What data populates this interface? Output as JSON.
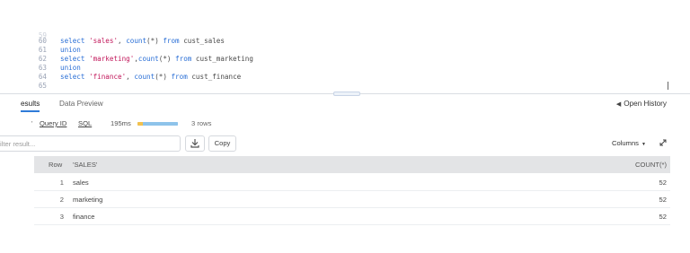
{
  "editor": {
    "clipped_line_number": "59",
    "lines": [
      {
        "num": "60",
        "parts": [
          {
            "t": "select ",
            "c": "kw"
          },
          {
            "t": "'sales'",
            "c": "str"
          },
          {
            "t": ", ",
            "c": ""
          },
          {
            "t": "count",
            "c": "kw"
          },
          {
            "t": "(*) ",
            "c": ""
          },
          {
            "t": "from",
            "c": "kw"
          },
          {
            "t": " cust_sales",
            "c": ""
          }
        ]
      },
      {
        "num": "61",
        "parts": [
          {
            "t": "union",
            "c": "kw"
          }
        ]
      },
      {
        "num": "62",
        "parts": [
          {
            "t": "select ",
            "c": "kw"
          },
          {
            "t": "'marketing'",
            "c": "str"
          },
          {
            "t": ",",
            "c": ""
          },
          {
            "t": "count",
            "c": "kw"
          },
          {
            "t": "(*) ",
            "c": ""
          },
          {
            "t": "from",
            "c": "kw"
          },
          {
            "t": " cust_marketing",
            "c": ""
          }
        ]
      },
      {
        "num": "63",
        "parts": [
          {
            "t": "union",
            "c": "kw"
          }
        ]
      },
      {
        "num": "64",
        "parts": [
          {
            "t": "select ",
            "c": "kw"
          },
          {
            "t": "'finance'",
            "c": "str"
          },
          {
            "t": ", ",
            "c": ""
          },
          {
            "t": "count",
            "c": "kw"
          },
          {
            "t": "(*) ",
            "c": ""
          },
          {
            "t": "from",
            "c": "kw"
          },
          {
            "t": " cust_finance",
            "c": ""
          }
        ]
      },
      {
        "num": "65",
        "parts": []
      }
    ]
  },
  "tabs": {
    "results": "esults",
    "data_preview": "Data Preview",
    "open_history": "Open History"
  },
  "query_info": {
    "mark": "'",
    "query_id": "Query ID",
    "sql": "SQL",
    "duration": "195ms",
    "rows": "3 rows",
    "progress": 1.0,
    "colors": {
      "compile": "#f2c14e",
      "execute": "#8ec3ea"
    }
  },
  "toolbar": {
    "filter_placeholder": "ilter result...",
    "copy_label": "Copy",
    "columns_label": "Columns",
    "download_icon": "download-icon",
    "expand_icon": "expand-icon"
  },
  "table": {
    "headers": {
      "row": "Row",
      "col1": "'SALES'",
      "col2": "COUNT(*)"
    },
    "rows": [
      {
        "row": "1",
        "col1": "sales",
        "col2": "52"
      },
      {
        "row": "2",
        "col1": "marketing",
        "col2": "52"
      },
      {
        "row": "3",
        "col1": "finance",
        "col2": "52"
      }
    ]
  },
  "colors": {
    "accent": "#2f7bd8",
    "keyword": "#2a6fd6",
    "string": "#c2185b",
    "header_bg": "#e3e4e6"
  }
}
